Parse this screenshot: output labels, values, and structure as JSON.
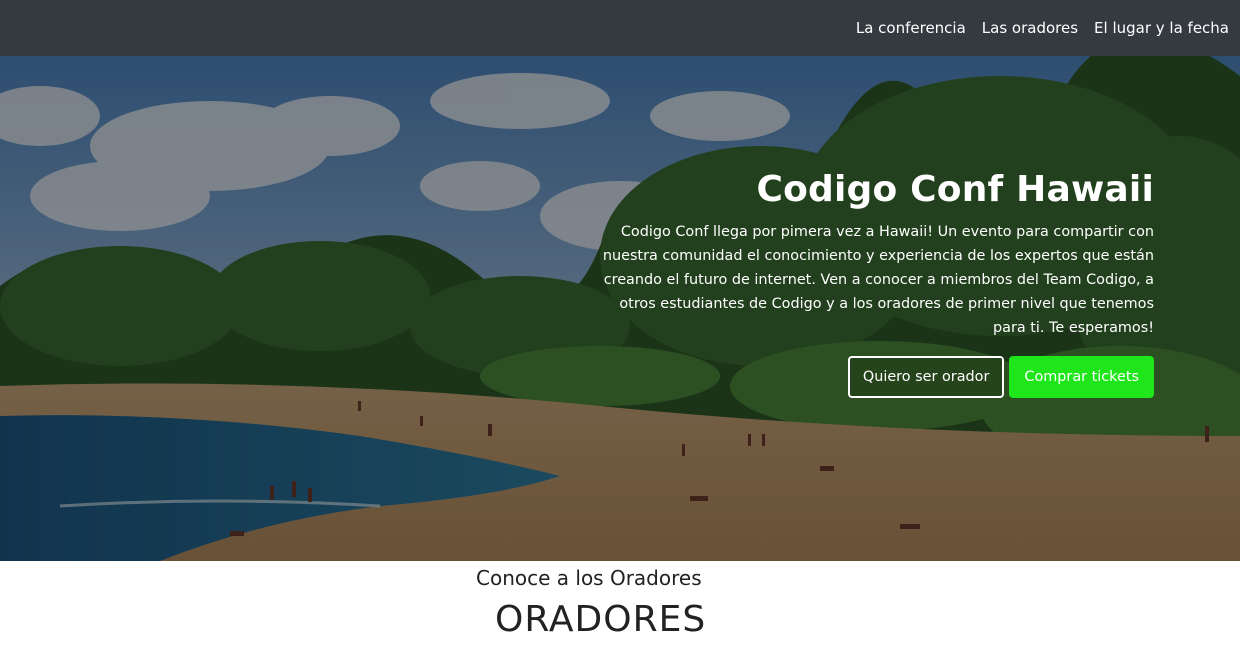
{
  "nav": {
    "links": [
      "La conferencia",
      "Las oradores",
      "El lugar y la fecha"
    ]
  },
  "hero": {
    "title": "Codigo Conf Hawaii",
    "description": "Codigo Conf llega por pimera vez a Hawaii! Un evento para compartir con nuestra comunidad el conocimiento y experiencia de los expertos que están creando el futuro de internet. Ven a conocer a miembros del Team Codigo, a otros estudiantes de Codigo y a los oradores de primer nivel que tenemos para ti. Te esperamos!",
    "button_outline_label": "Quiero ser orador",
    "button_primary_label": "Comprar tickets"
  },
  "speakers_section": {
    "subtitle": "Conoce a los Oradores",
    "title": "ORADORES"
  },
  "colors": {
    "navbar": "#343a40",
    "accent_green": "#1ee61a"
  }
}
